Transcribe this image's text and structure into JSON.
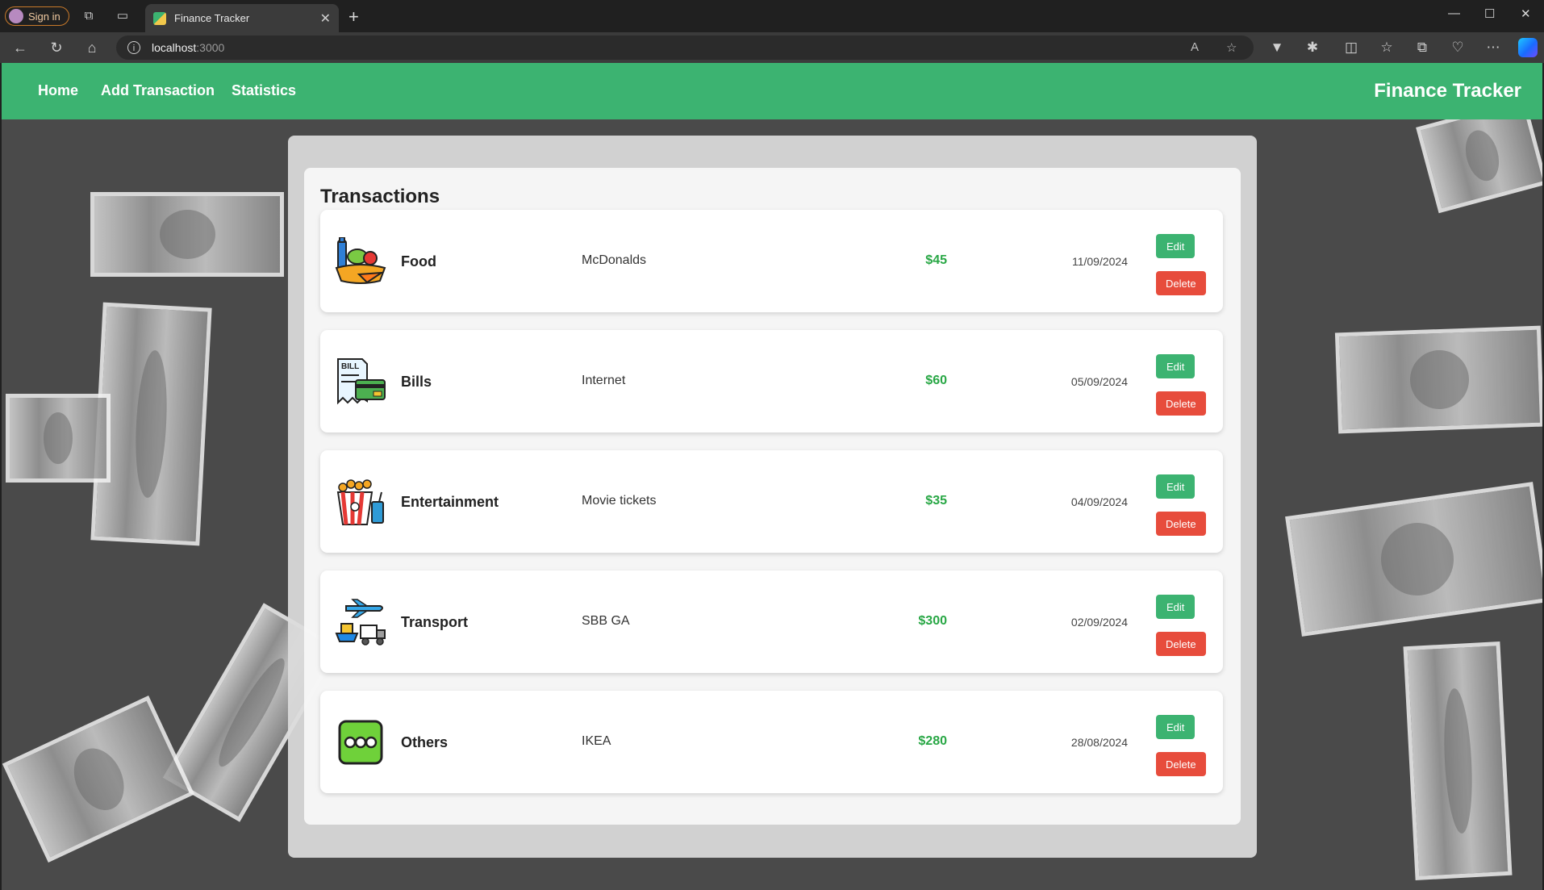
{
  "browser": {
    "signin_label": "Sign in",
    "tab_title": "Finance Tracker",
    "url_host": "localhost",
    "url_port": ":3000"
  },
  "navbar": {
    "links": [
      "Home",
      "Add Transaction",
      "Statistics"
    ],
    "brand": "Finance Tracker",
    "color": "#3cb371"
  },
  "transactions": {
    "heading": "Transactions",
    "edit_label": "Edit",
    "delete_label": "Delete",
    "items": [
      {
        "category": "Food",
        "icon": "food-icon",
        "description": "McDonalds",
        "amount": "$45",
        "date": "11/09/2024"
      },
      {
        "category": "Bills",
        "icon": "bill-icon",
        "description": "Internet",
        "amount": "$60",
        "date": "05/09/2024"
      },
      {
        "category": "Entertainment",
        "icon": "popcorn-icon",
        "description": "Movie tickets",
        "amount": "$35",
        "date": "04/09/2024"
      },
      {
        "category": "Transport",
        "icon": "transport-icon",
        "description": "SBB GA",
        "amount": "$300",
        "date": "02/09/2024"
      },
      {
        "category": "Others",
        "icon": "more-icon",
        "description": "IKEA",
        "amount": "$280",
        "date": "28/08/2024"
      }
    ]
  },
  "colors": {
    "edit": "#3cb371",
    "delete": "#e74c3c",
    "amount": "#28a745"
  }
}
